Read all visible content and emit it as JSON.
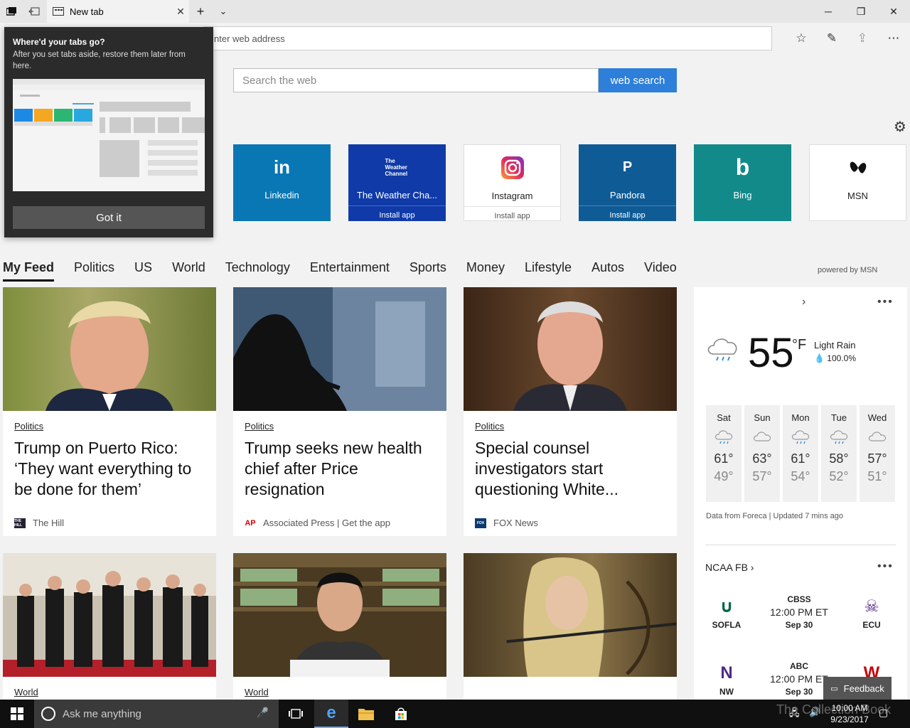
{
  "browser": {
    "tab_title": "New tab",
    "address_placeholder": "nter web address"
  },
  "popup": {
    "title": "Where'd your tabs go?",
    "description": "After you set tabs aside, restore them later from here.",
    "button": "Got it"
  },
  "search": {
    "placeholder": "Search the web",
    "button": "web search"
  },
  "top_sites": [
    {
      "label": "Linkedin",
      "icon_text": "in",
      "install": "",
      "color": "#0a77b5"
    },
    {
      "label": "The Weather Cha...",
      "icon_text": "The Weather Channel",
      "install": "Install app",
      "color": "#0f3aa8"
    },
    {
      "label": "Instagram",
      "icon_text": "",
      "install": "Install app",
      "color": "#ffffff"
    },
    {
      "label": "Pandora",
      "icon_text": "P",
      "install": "Install app",
      "color": "#0f5b96"
    },
    {
      "label": "Bing",
      "icon_text": "b",
      "install": "",
      "color": "#128a8a"
    },
    {
      "label": "MSN",
      "icon_text": "",
      "install": "",
      "color": "#ffffff"
    }
  ],
  "feed_nav": [
    "My Feed",
    "Politics",
    "US",
    "World",
    "Technology",
    "Entertainment",
    "Sports",
    "Money",
    "Lifestyle",
    "Autos",
    "Video"
  ],
  "powered_by": "powered by MSN",
  "cards": [
    {
      "category": "Politics",
      "headline": "Trump on Puerto Rico: ‘They want everything to be done for them’",
      "source": "The Hill",
      "source_logo": "THE HILL"
    },
    {
      "category": "Politics",
      "headline": "Trump seeks new health chief after Price resignation",
      "source": "Associated Press | Get the app",
      "source_logo": "AP"
    },
    {
      "category": "Politics",
      "headline": "Special counsel investigators start questioning White...",
      "source": "FOX News",
      "source_logo": "FOX"
    },
    {
      "category": "World",
      "headline": "",
      "source": "",
      "source_logo": ""
    },
    {
      "category": "World",
      "headline": "",
      "source": "",
      "source_logo": ""
    },
    {
      "category": "",
      "headline": "",
      "source": "",
      "source_logo": ""
    }
  ],
  "weather": {
    "temp": "55",
    "unit": "°F",
    "condition": "Light Rain",
    "precip": "100.0%",
    "forecast": [
      {
        "day": "Sat",
        "high": "61°",
        "low": "49°",
        "icon": "rain-cloud-icon"
      },
      {
        "day": "Sun",
        "high": "63°",
        "low": "57°",
        "icon": "cloud-icon"
      },
      {
        "day": "Mon",
        "high": "61°",
        "low": "54°",
        "icon": "rain-cloud-icon"
      },
      {
        "day": "Tue",
        "high": "58°",
        "low": "52°",
        "icon": "rain-cloud-icon"
      },
      {
        "day": "Wed",
        "high": "57°",
        "low": "51°",
        "icon": "cloud-icon"
      }
    ],
    "note": "Data from Foreca | Updated 7 mins ago"
  },
  "ncaa": {
    "title": "NCAA FB",
    "games": [
      {
        "home": "SOFLA",
        "away": "ECU",
        "network": "CBSS",
        "time": "12:00 PM ET",
        "date": "Sep 30"
      },
      {
        "home": "NW",
        "away": "",
        "network": "ABC",
        "time": "12:00 PM ET",
        "date": "Sep 30"
      }
    ]
  },
  "feedback": "Feedback",
  "taskbar": {
    "search_placeholder": "Ask me anything",
    "time": "10:00 AM",
    "date": "9/23/2017",
    "watermark": "The Collection Book"
  },
  "colors": {
    "accent": "#2d7fd9",
    "taskbar": "#101010"
  }
}
